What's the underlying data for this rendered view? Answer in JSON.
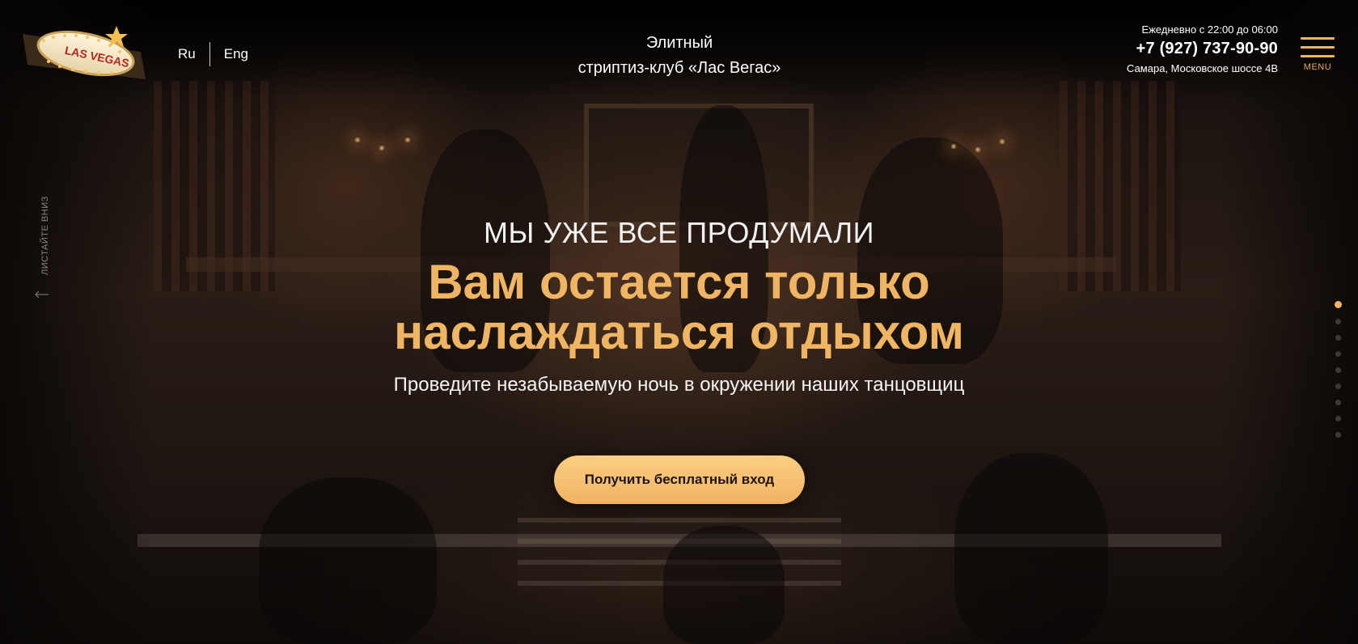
{
  "header": {
    "logo_alt": "LAS VEGAS",
    "languages": [
      "Ru",
      "Eng"
    ],
    "club_name_line1": "Элитный",
    "club_name_line2": "стриптиз-клуб «Лас Вегас»",
    "hours": "Ежедневно с 22:00 до 06:00",
    "phone": "+7 (927) 737-90-90",
    "address": "Самара, Московское шоссе 4В",
    "menu_label": "MENU"
  },
  "side": {
    "scroll_hint": "ЛИСТАЙТЕ ВНИЗ"
  },
  "hero": {
    "kicker": "МЫ УЖЕ ВСЕ ПРОДУМАЛИ",
    "headline_line1": "Вам остается только",
    "headline_line2": "наслаждаться отдыхом",
    "subtitle": "Проведите незабываемую ночь в окружении наших танцовщиц",
    "cta_label": "Получить бесплатный вход"
  },
  "pagination": {
    "total": 9,
    "active_index": 0
  },
  "colors": {
    "accent": "#f0b563",
    "cta_top": "#fbcf83",
    "background": "#0b0908"
  }
}
